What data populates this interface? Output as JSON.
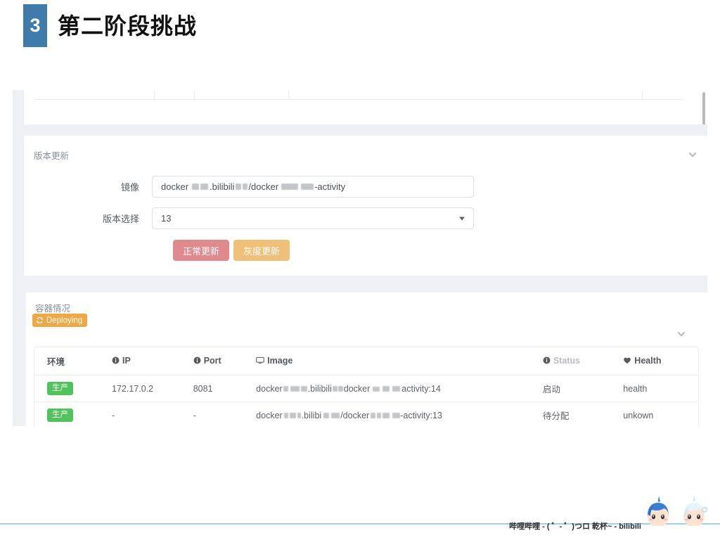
{
  "slide": {
    "number": "3",
    "title": "第二阶段挑战"
  },
  "clipped_table_row": {
    "cells": [
      "",
      "",
      "",
      "",
      ""
    ]
  },
  "version_panel": {
    "title": "版本更新",
    "chevron_icon": "chevron-down-icon",
    "image_label": "镜像",
    "image_value_prefix": "docker",
    "image_value_mid": ".bilibili",
    "image_value_mid2": "/docker",
    "image_value_suffix": "-activity",
    "version_label": "版本选择",
    "version_value": "13",
    "buttons": {
      "normal_update": "正常更新",
      "gray_update": "灰度更新"
    },
    "colors": {
      "normal_update": "#e08a8e",
      "gray_update": "#f0c078"
    }
  },
  "container_panel": {
    "title": "容器情况",
    "status_badge": {
      "label": "Deploying",
      "icon": "refresh-icon",
      "color": "#eea845"
    },
    "chevron_icon": "chevron-down-icon",
    "table": {
      "headers": {
        "env": "环境",
        "ip": "IP",
        "port": "Port",
        "image": "Image",
        "status": "Status",
        "health": "Health"
      },
      "header_icons": {
        "ip": "info-icon",
        "port": "info-icon",
        "image": "monitor-icon",
        "status": "info-icon",
        "health": "heart-icon"
      },
      "rows": [
        {
          "env": "生产",
          "ip": "172.17.0.2",
          "port": "8081",
          "image_prefix": "docker",
          "image_mid": ".bilibili",
          "image_mid2": "docker",
          "image_suffix": "activity:14",
          "status": "启动",
          "health": "health"
        },
        {
          "env": "生产",
          "ip": "-",
          "port": "-",
          "image_prefix": "docker",
          "image_mid": ".bilibi",
          "image_mid2": "/docker",
          "image_suffix": "-activity:13",
          "status": "待分配",
          "health": "unkown"
        }
      ]
    },
    "env_badge_color": "#52c25c"
  },
  "footer": {
    "text": "哔哩哔哩 - ( ゜- ゜)つロ 乾杯~ - bilibili",
    "accent_color": "#9fd2ea",
    "mascot_left": "mascot-22-icon",
    "mascot_right": "mascot-33-icon"
  }
}
